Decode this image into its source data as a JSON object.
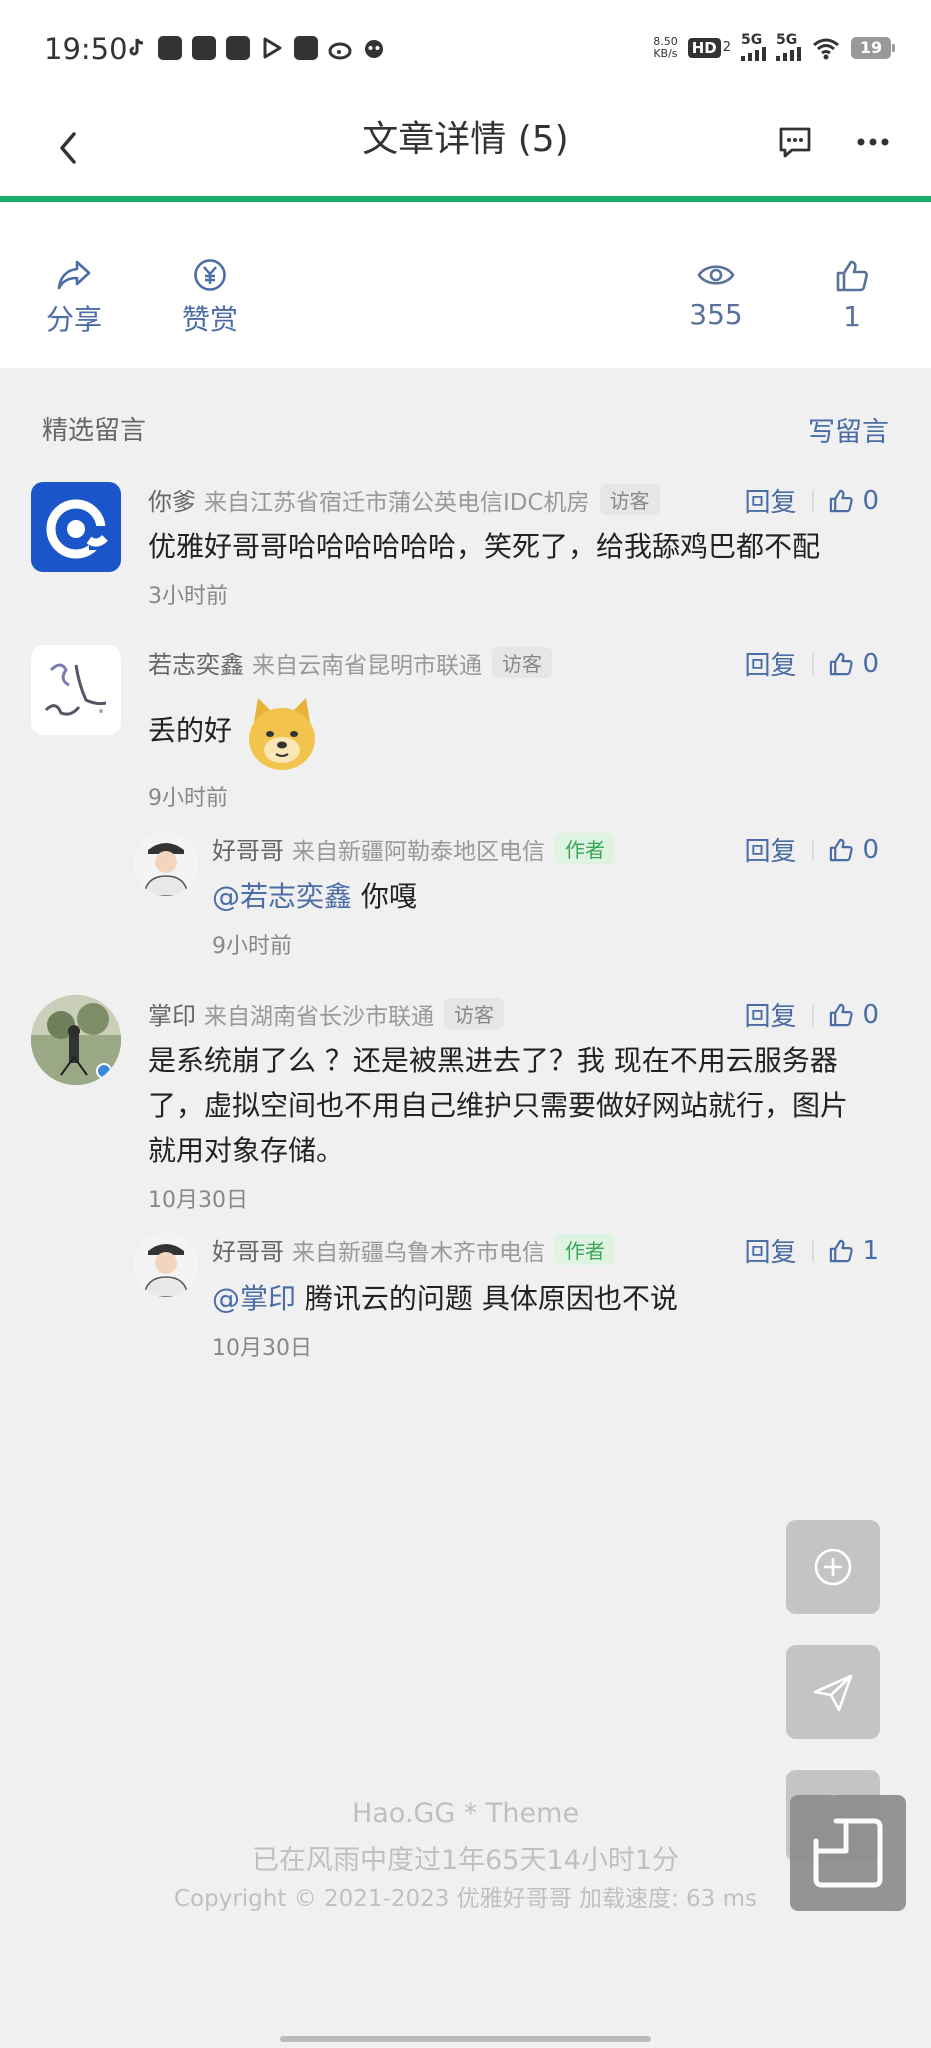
{
  "status_bar": {
    "time": "19:50",
    "speed_value": "8.50",
    "speed_unit": "KB/s",
    "hd": "HD",
    "hd_sub": "2",
    "sig1": "5G",
    "sig2": "5G",
    "battery": "19"
  },
  "header": {
    "title": "文章详情 (5)"
  },
  "reading_progress_percent": 100,
  "actions": {
    "share": "分享",
    "reward": "赞赏",
    "views": "355",
    "likes": "1"
  },
  "comments_section": {
    "title": "精选留言",
    "write": "写留言"
  },
  "comments": [
    {
      "name": "你爹",
      "from": "来自江苏省宿迁市蒲公英电信IDC机房",
      "badge": "访客",
      "reply": "回复",
      "likes": "0",
      "text": "优雅好哥哥哈哈哈哈哈哈，笑死了，给我舔鸡巴都不配",
      "time": "3小时前"
    },
    {
      "name": "若志奕鑫",
      "from": "来自云南省昆明市联通",
      "badge": "访客",
      "reply": "回复",
      "likes": "0",
      "text": "丢的好",
      "time": "9小时前"
    },
    {
      "name": "好哥哥",
      "from": "来自新疆阿勒泰地区电信",
      "badge": "作者",
      "reply": "回复",
      "likes": "0",
      "mention": "@若志奕鑫",
      "text": "你嘎",
      "time": "9小时前"
    },
    {
      "name": "掌印",
      "from": "来自湖南省长沙市联通",
      "badge": "访客",
      "reply": "回复",
      "likes": "0",
      "text_line1": "是系统崩了么 ？还是被黑进去了？我 现在不用云服务器",
      "text_line2": "了，虚拟空间也不用自己维护只需要做好网站就行，图片",
      "text_line3": "就用对象存储。",
      "time": "10月30日"
    },
    {
      "name": "好哥哥",
      "from": "来自新疆乌鲁木齐市电信",
      "badge": "作者",
      "reply": "回复",
      "likes": "1",
      "mention": "@掌印",
      "text": "腾讯云的问题 具体原因也不说",
      "time": "10月30日"
    }
  ],
  "footer": {
    "line1": "Hao.GG * Theme",
    "line2": "已在风雨中度过1年65天14小时1分",
    "line3": "Copyright © 2021-2023 优雅好哥哥 加载速度: 63 ms"
  },
  "colors": {
    "accent": "#4a6da7",
    "progress": "#1aad6b",
    "author_badge": "#3aa657"
  }
}
